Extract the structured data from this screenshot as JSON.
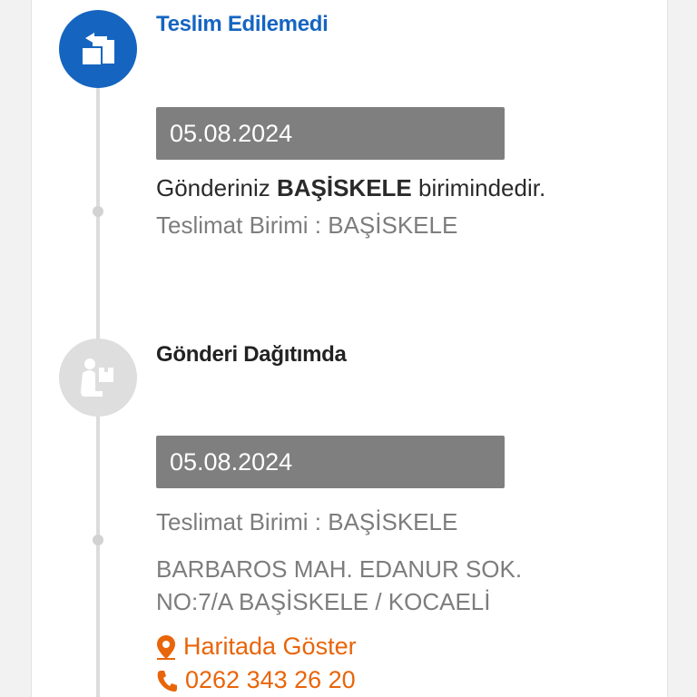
{
  "colors": {
    "accent_blue": "#1565c0",
    "link_orange": "#e8650a",
    "chip_grey": "#7f7f7f"
  },
  "events": [
    {
      "status": "Teslim Edilemedi",
      "status_icon": "return-package-icon",
      "date": "05.08.2024",
      "message_prefix": "Gönderiniz ",
      "message_unit": "BAŞİSKELE",
      "message_suffix": " birimindedir.",
      "delivery_unit": "Teslimat Birimi : BAŞİSKELE"
    },
    {
      "status": "Gönderi Dağıtımda",
      "status_icon": "courier-package-icon",
      "date": "05.08.2024",
      "delivery_unit": "Teslimat Birimi : BAŞİSKELE",
      "address_line1": "BARBAROS MAH. EDANUR SOK.",
      "address_line2": "NO:7/A BAŞİSKELE / KOCAELİ",
      "map_link": "Haritada Göster",
      "phone": "0262 343 26 20"
    }
  ]
}
